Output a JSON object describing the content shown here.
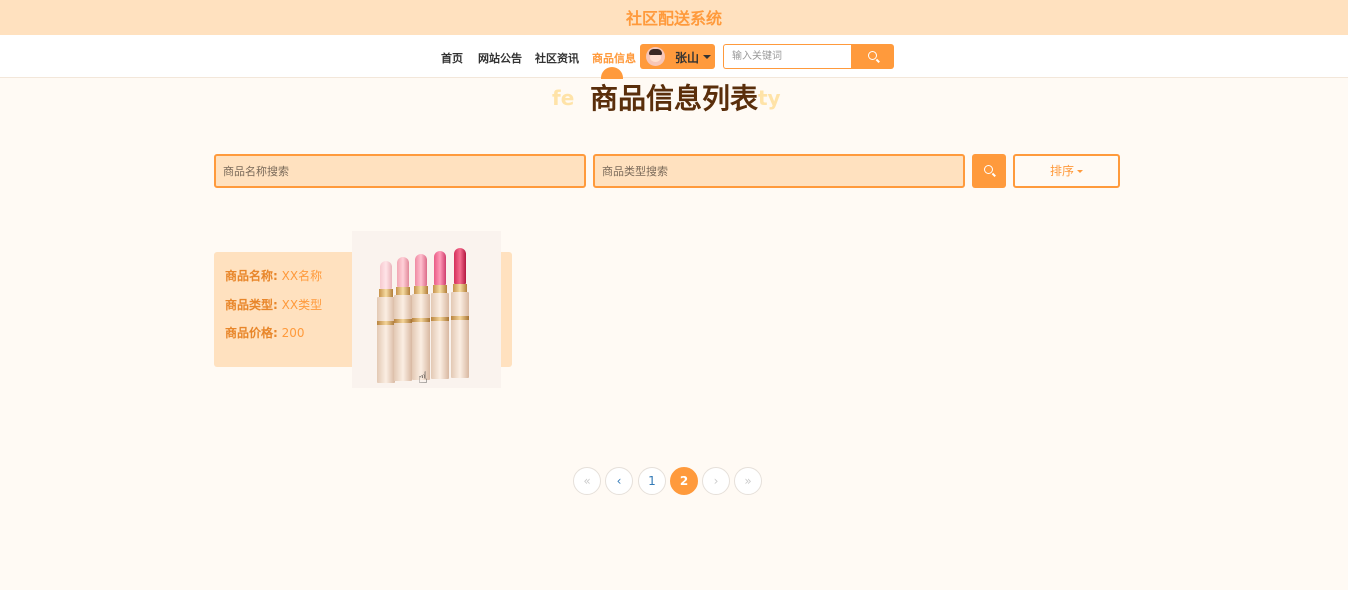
{
  "header": {
    "site_title": "社区配送系统"
  },
  "nav": {
    "links": [
      "首页",
      "网站公告",
      "社区资讯",
      "商品信息"
    ],
    "active_index": 3,
    "user": {
      "name": "张山"
    },
    "search": {
      "placeholder": "输入关键词",
      "button_icon": "search-icon"
    }
  },
  "page": {
    "title": "商品信息列表",
    "bg_word_left": "fe",
    "bg_word_right": "ty"
  },
  "filters": {
    "name_placeholder": "商品名称搜索",
    "type_placeholder": "商品类型搜索",
    "search_icon": "search-icon",
    "sort_label": "排序"
  },
  "products": [
    {
      "name_label": "商品名称:",
      "name": "XX名称",
      "type_label": "商品类型:",
      "type": "XX类型",
      "price_label": "商品价格:",
      "price": "200",
      "image": "lipstick-product-image"
    }
  ],
  "pagination": {
    "first": "«",
    "prev": "‹",
    "pages": [
      "1",
      "2"
    ],
    "current": "2",
    "next": "›",
    "last": "»"
  },
  "colors": {
    "accent": "#ff9a3c",
    "header_bg": "#ffe1bf",
    "title_brown": "#5a2e0b",
    "page_bg": "#fffaf4"
  }
}
